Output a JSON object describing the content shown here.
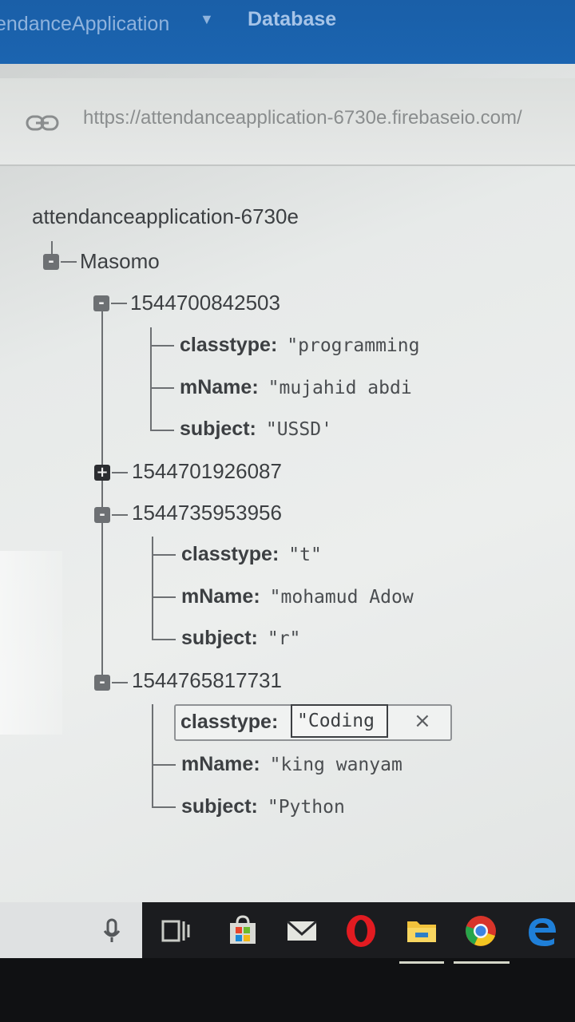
{
  "topbar": {
    "app_title": "endanceApplication",
    "section_title": "Database"
  },
  "urlbar": {
    "url": "https://attendanceapplication-6730e.firebaseio.com/"
  },
  "tree": {
    "root": "attendanceapplication-6730e",
    "group": "Masomo",
    "records": [
      {
        "id": "1544700842503",
        "expanded": true,
        "fields": [
          {
            "key": "classtype:",
            "value": "\"programming"
          },
          {
            "key": "mName:",
            "value": "\"mujahid abdi"
          },
          {
            "key": "subject:",
            "value": "\"USSD'"
          }
        ]
      },
      {
        "id": "1544701926087",
        "expanded": false,
        "fields": []
      },
      {
        "id": "1544735953956",
        "expanded": true,
        "fields": [
          {
            "key": "classtype:",
            "value": "\"t\""
          },
          {
            "key": "mName:",
            "value": "\"mohamud Adow"
          },
          {
            "key": "subject:",
            "value": "\"r\""
          }
        ]
      },
      {
        "id": "1544765817731",
        "expanded": true,
        "fields": [
          {
            "key": "classtype:",
            "value": "\"Coding"
          },
          {
            "key": "mName:",
            "value": "\"king  wanyam"
          },
          {
            "key": "subject:",
            "value": "\"Python"
          }
        ]
      }
    ],
    "toggle_expanded": "-",
    "toggle_collapsed": "+",
    "close_glyph": "×"
  },
  "taskbar": {
    "icons": [
      "microphone-icon",
      "task-view-icon",
      "store-icon",
      "mail-icon",
      "opera-icon",
      "file-explorer-icon",
      "chrome-icon",
      "edge-icon"
    ]
  }
}
